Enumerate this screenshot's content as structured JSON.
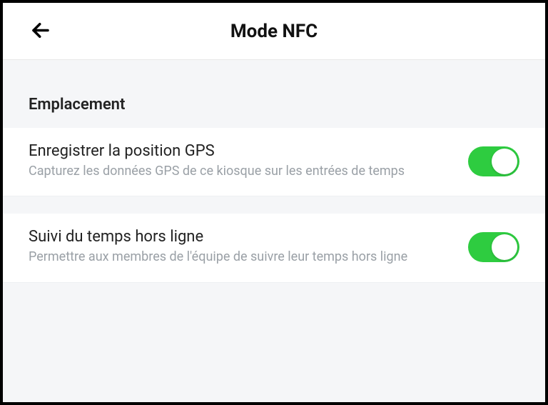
{
  "header": {
    "title": "Mode NFC"
  },
  "section": {
    "title": "Emplacement"
  },
  "settings": [
    {
      "title": "Enregistrer la position GPS",
      "description": "Capturez les données GPS de ce kiosque sur les entrées de temps",
      "enabled": true
    },
    {
      "title": "Suivi du temps hors ligne",
      "description": "Permettre aux membres de l'équipe de suivre leur temps hors ligne",
      "enabled": true
    }
  ]
}
